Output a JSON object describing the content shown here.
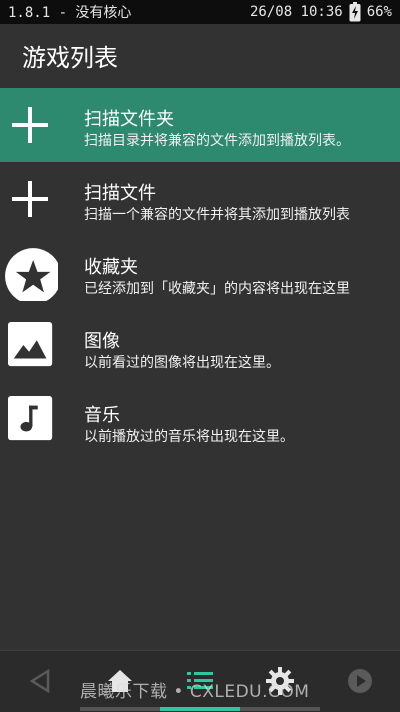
{
  "status": {
    "left": "1.8.1 - 没有核心",
    "datetime": "26/08 10:36",
    "battery": "66%"
  },
  "appbar": {
    "title": "游戏列表"
  },
  "items": [
    {
      "icon": "plus-icon",
      "title": "扫描文件夹",
      "desc": "扫描目录并将兼容的文件添加到播放列表。",
      "selected": true
    },
    {
      "icon": "plus-icon",
      "title": "扫描文件",
      "desc": "扫描一个兼容的文件并将其添加到播放列表",
      "selected": false
    },
    {
      "icon": "star-icon",
      "title": "收藏夹",
      "desc": "已经添加到「收藏夹」的内容将出现在这里",
      "selected": false
    },
    {
      "icon": "image-icon",
      "title": "图像",
      "desc": "以前看过的图像将出现在这里。",
      "selected": false
    },
    {
      "icon": "music-icon",
      "title": "音乐",
      "desc": "以前播放过的音乐将出现在这里。",
      "selected": false
    }
  ],
  "watermark": "晨曦乐下载 • CXLEDU.COM",
  "colors": {
    "accent": "#2d8a6f",
    "tab_active": "#2ec8a0",
    "background": "#323232"
  }
}
